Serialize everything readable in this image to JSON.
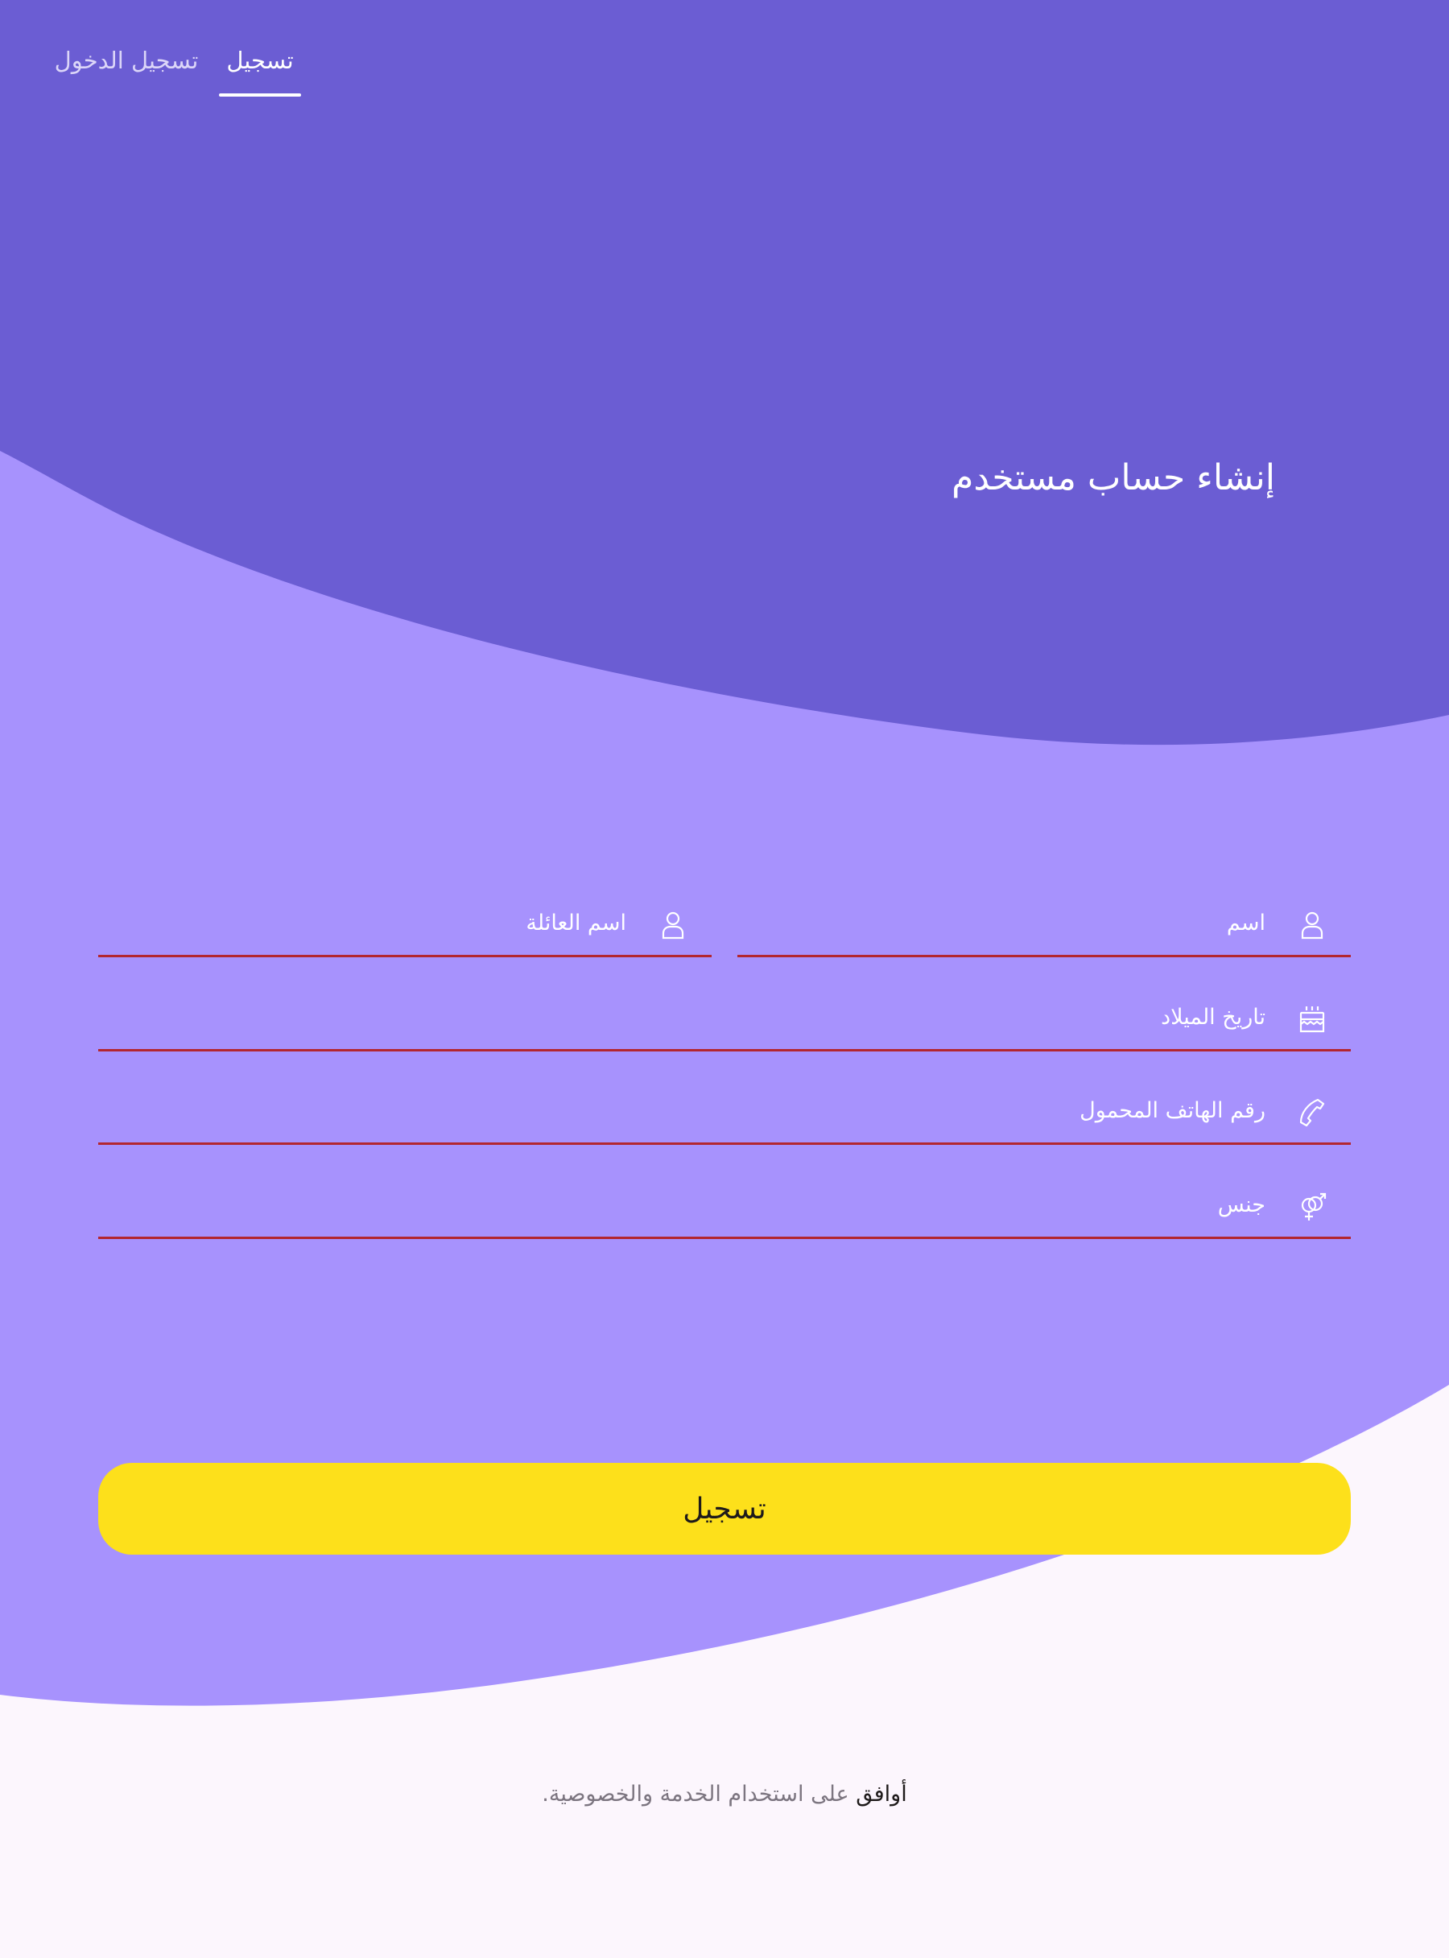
{
  "tabs": {
    "register_label": "تسجيل",
    "login_label": "تسجيل الدخول",
    "active": "register"
  },
  "title": "إنشاء حساب مستخدم",
  "form": {
    "first_name": {
      "placeholder": "اسم",
      "value": "",
      "icon": "person-icon"
    },
    "last_name": {
      "placeholder": "اسم العائلة",
      "value": "",
      "icon": "person-icon"
    },
    "birthdate": {
      "placeholder": "تاريخ الميلاد",
      "value": "",
      "icon": "cake-icon"
    },
    "phone": {
      "placeholder": "رقم الهاتف المحمول",
      "value": "",
      "icon": "phone-icon"
    },
    "gender": {
      "placeholder": "جنس",
      "value": "",
      "icon": "gender-icon"
    }
  },
  "register_button": "تسجيل",
  "terms": {
    "agree": "أوافق",
    "rest": " على استخدام الخدمة والخصوصية."
  },
  "colors": {
    "top_band": "#6b5dd3",
    "middle_band": "#a792fd",
    "page_bg": "#fcf6fd",
    "field_underline": "#b3262f",
    "button": "#fde01b"
  }
}
